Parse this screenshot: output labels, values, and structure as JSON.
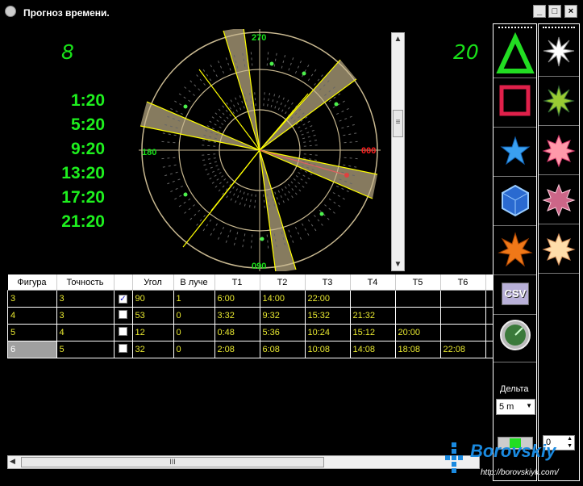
{
  "window": {
    "title": "Прогноз времени.",
    "min_label": "_",
    "max_label": "□",
    "close_label": "×"
  },
  "left": {
    "big_number": "8",
    "times": [
      "1:20",
      "5:20",
      "9:20",
      "13:20",
      "17:20",
      "21:20"
    ]
  },
  "right": {
    "big_number": "20"
  },
  "dial": {
    "label_top": "270",
    "label_left": "180",
    "label_right": "000",
    "label_bottom": "090"
  },
  "table": {
    "headers": [
      "Фигура",
      "Точность",
      "",
      "Угол",
      "В луче",
      "T1",
      "T2",
      "T3",
      "T4",
      "T5",
      "T6"
    ],
    "rows": [
      {
        "figure": "3",
        "accuracy": "3",
        "checked": true,
        "angle": "90",
        "in_ray": "1",
        "t1": "6:00",
        "t2": "14:00",
        "t3": "22:00",
        "t4": "",
        "t5": "",
        "t6": ""
      },
      {
        "figure": "4",
        "accuracy": "3",
        "checked": false,
        "angle": "53",
        "in_ray": "0",
        "t1": "3:32",
        "t2": "9:32",
        "t3": "15:32",
        "t4": "21:32",
        "t5": "",
        "t6": ""
      },
      {
        "figure": "5",
        "accuracy": "4",
        "checked": false,
        "angle": "12",
        "in_ray": "0",
        "t1": "0:48",
        "t2": "5:36",
        "t3": "10:24",
        "t4": "15:12",
        "t5": "20:00",
        "t6": ""
      },
      {
        "figure": "6",
        "accuracy": "5",
        "checked": false,
        "angle": "32",
        "in_ray": "0",
        "t1": "2:08",
        "t2": "6:08",
        "t3": "10:08",
        "t4": "14:08",
        "t5": "18:08",
        "t6": "22:08"
      }
    ]
  },
  "scroll": {
    "h_grip": "III",
    "v_grip": "≡"
  },
  "toolbar": {
    "delta_label": "Дельта",
    "delta_value": "5 m",
    "spin_value": "0",
    "csv_label": "CSV"
  },
  "watermark": {
    "brand": "Borovskiy",
    "url": "http://borovskiyk.com/"
  },
  "colors": {
    "triangle": "#22dd22",
    "square": "#e0204a",
    "star": "#3aa0f0",
    "accent": "#19e019",
    "ray": "#ffff00"
  }
}
